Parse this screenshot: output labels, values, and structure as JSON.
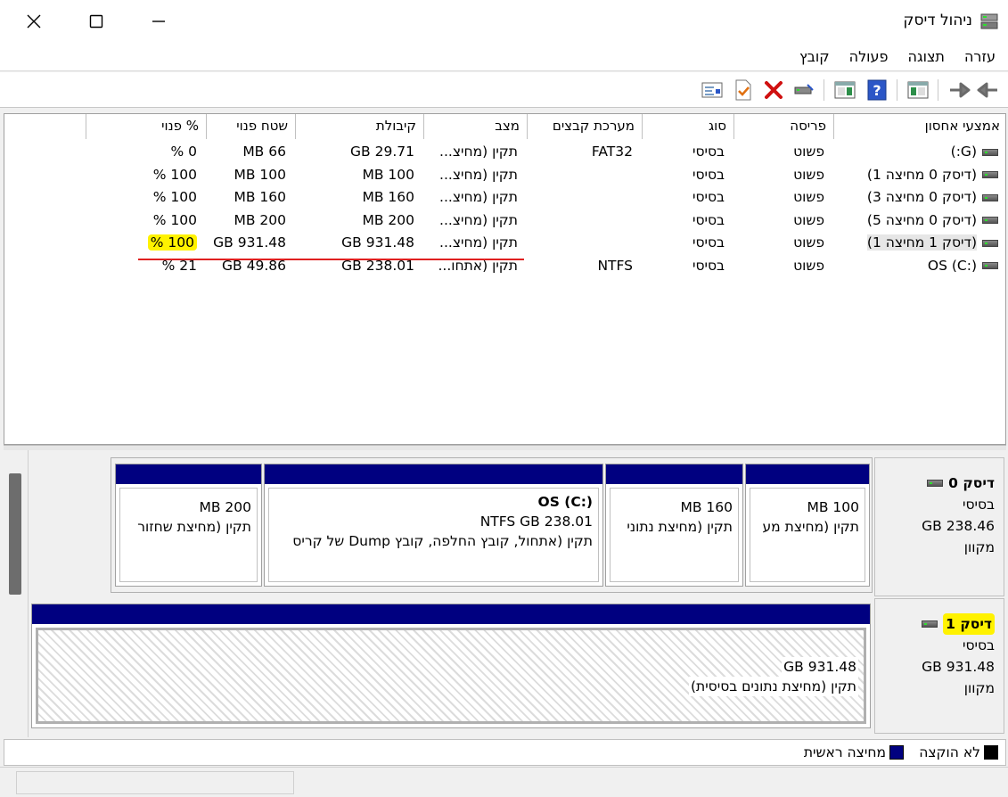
{
  "window": {
    "title": "ניהול דיסק"
  },
  "menu": {
    "items": [
      "קובץ",
      "פעולה",
      "תצוגה",
      "עזרה"
    ]
  },
  "toolbar": {
    "icons": [
      "back-arrow-icon",
      "forward-arrow-icon",
      "properties-icon",
      "help-icon",
      "view-pane-icon",
      "disk-connect-icon",
      "delete-icon",
      "check-icon",
      "settings-list-icon"
    ]
  },
  "columns": [
    "אמצעי אחסון",
    "פריסה",
    "סוג",
    "מערכת קבצים",
    "מצב",
    "קיבולת",
    "שטח פנוי",
    "% פנוי"
  ],
  "volumes": [
    {
      "name": "(G:)",
      "layout": "פשוט",
      "type": "בסיסי",
      "fs": "FAT32",
      "status": "תקין (מחיצ...",
      "capacity": "29.71 GB",
      "free": "66 MB",
      "pct": "0 %"
    },
    {
      "name": "(דיסק 0 מחיצה 1)",
      "layout": "פשוט",
      "type": "בסיסי",
      "fs": "",
      "status": "תקין (מחיצ...",
      "capacity": "100 MB",
      "free": "100 MB",
      "pct": "100 %"
    },
    {
      "name": "(דיסק 0 מחיצה 3)",
      "layout": "פשוט",
      "type": "בסיסי",
      "fs": "",
      "status": "תקין (מחיצ...",
      "capacity": "160 MB",
      "free": "160 MB",
      "pct": "100 %"
    },
    {
      "name": "(דיסק 0 מחיצה 5)",
      "layout": "פשוט",
      "type": "בסיסי",
      "fs": "",
      "status": "תקין (מחיצ...",
      "capacity": "200 MB",
      "free": "200 MB",
      "pct": "100 %"
    },
    {
      "name": "(דיסק 1 מחיצה 1)",
      "layout": "פשוט",
      "type": "בסיסי",
      "fs": "",
      "status": "תקין (מחיצ...",
      "capacity": "931.48 GB",
      "free": "931.48 GB",
      "pct": "100 %"
    },
    {
      "name": "OS (C:)",
      "layout": "פשוט",
      "type": "בסיסי",
      "fs": "NTFS",
      "status": "תקין (אתחו...",
      "capacity": "238.01 GB",
      "free": "49.86 GB",
      "pct": "21 %"
    }
  ],
  "disks": [
    {
      "name": "דיסק 0",
      "type": "בסיסי",
      "size": "238.46 GB",
      "state": "מקוון",
      "partitions": [
        {
          "title": "",
          "size": "100 MB",
          "status": "תקין (מחיצת מע"
        },
        {
          "title": "",
          "size": "160 MB",
          "status": "תקין (מחיצת נתוני"
        },
        {
          "title": "OS  (C:)",
          "size": "238.01 NTFS GB",
          "status": "תקין (אתחול, קובץ החלפה, קובץ Dump של קריס"
        },
        {
          "title": "",
          "size": "200 MB",
          "status": "תקין (מחיצת שחזור"
        }
      ]
    },
    {
      "name": "דיסק 1",
      "type": "בסיסי",
      "size": "931.48 GB",
      "state": "מקוון",
      "partitions": [
        {
          "title": "",
          "size": "931.48 GB",
          "status": "תקין (מחיצת נתונים בסיסית)"
        }
      ]
    }
  ],
  "legend": {
    "unallocated": "לא הוקצה",
    "primary": "מחיצה ראשית"
  },
  "colors": {
    "primary_bar": "#000080",
    "highlight": "#fff200",
    "underline": "#e02020"
  }
}
